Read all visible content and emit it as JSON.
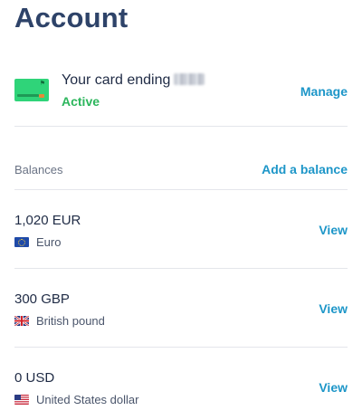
{
  "header": {
    "title": "Account"
  },
  "card": {
    "title": "Your card ending",
    "status": "Active",
    "action_label": "Manage"
  },
  "balances": {
    "section_label": "Balances",
    "add_label": "Add a balance",
    "items": [
      {
        "amount": "1,020 EUR",
        "currency": "Euro",
        "flag_icon": "eu-flag-icon",
        "action_label": "View"
      },
      {
        "amount": "300 GBP",
        "currency": "British pound",
        "flag_icon": "gb-flag-icon",
        "action_label": "View"
      },
      {
        "amount": "0 USD",
        "currency": "United States dollar",
        "flag_icon": "us-flag-icon",
        "action_label": "View"
      }
    ]
  },
  "colors": {
    "title": "#2e4369",
    "link": "#1d96c8",
    "active": "#2cb65c",
    "card": "#2fd479",
    "divider": "#e4e6eb"
  }
}
